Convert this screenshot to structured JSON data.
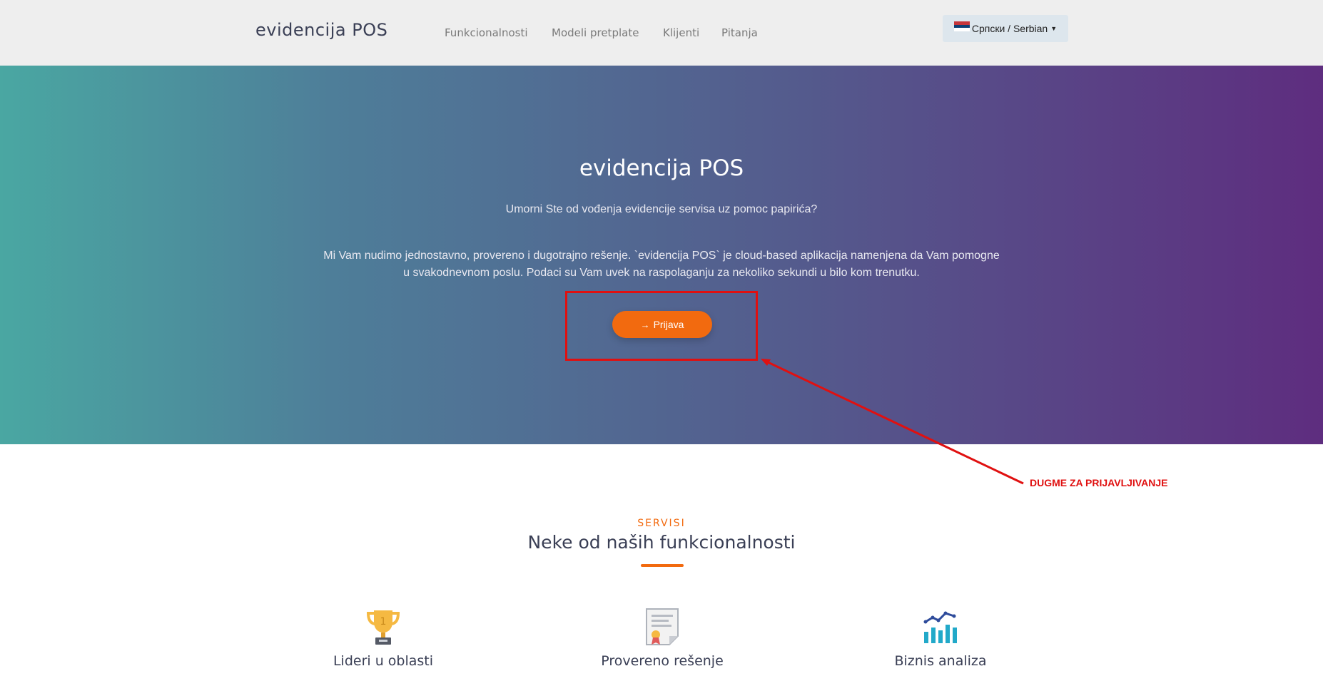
{
  "header": {
    "brand": "evidencija POS",
    "nav": [
      "Funkcionalnosti",
      "Modeli pretplate",
      "Klijenti",
      "Pitanja"
    ],
    "language": "Српски / Serbian"
  },
  "hero": {
    "title": "evidencija POS",
    "subtitle": "Umorni Ste od vođenja evidencije servisa uz pomoc papirića?",
    "description": "Mi Vam nudimo jednostavno, provereno i dugotrajno rešenje. `evidencija POS` je cloud-based aplikacija namenjena da Vam pomogne u svakodnevnom poslu. Podaci su Vam uvek na raspolaganju za nekoliko sekundi u bilo kom trenutku.",
    "login_button": "Prijava"
  },
  "annotation": {
    "text": "DUGME ZA PRIJAVLJIVANJE",
    "color": "#e01010"
  },
  "services": {
    "kicker": "SERVISI",
    "title": "Neke od naših funkcionalnosti",
    "features": [
      {
        "label": "Lideri u oblasti",
        "icon": "trophy-icon"
      },
      {
        "label": "Provereno rešenje",
        "icon": "certificate-icon"
      },
      {
        "label": "Biznis analiza",
        "icon": "bar-chart-icon"
      }
    ]
  },
  "colors": {
    "accent": "#f26a0f",
    "gradient_start": "#4aa7a2",
    "gradient_end": "#5e2d7f",
    "topbar": "#eeeeee"
  }
}
